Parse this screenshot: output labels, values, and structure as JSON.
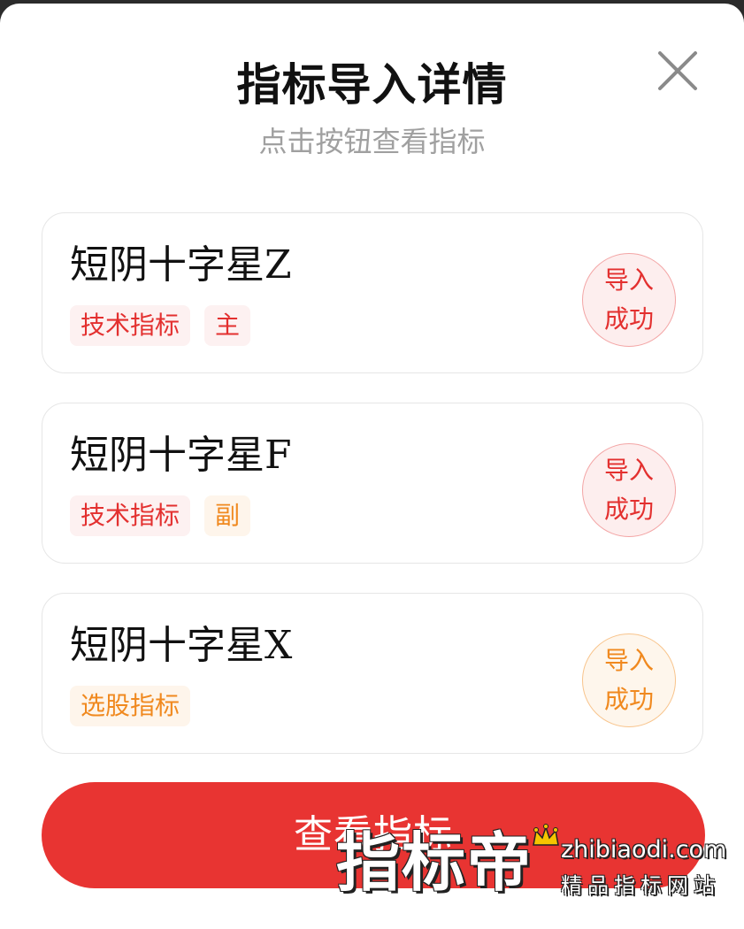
{
  "dialog": {
    "title": "指标导入详情",
    "subtitle": "点击按钮查看指标",
    "close_icon": "close-icon"
  },
  "items": [
    {
      "name": "短阴十字星Z",
      "tags": [
        {
          "label": "技术指标",
          "color": "#e3302f"
        },
        {
          "label": "主",
          "color": "#e3302f"
        }
      ],
      "status_line1": "导入",
      "status_line2": "成功",
      "status_color": "#e3302f"
    },
    {
      "name": "短阴十字星F",
      "tags": [
        {
          "label": "技术指标",
          "color": "#e3302f"
        },
        {
          "label": "副",
          "color": "#f0891f"
        }
      ],
      "status_line1": "导入",
      "status_line2": "成功",
      "status_color": "#e3302f"
    },
    {
      "name": "短阴十字星X",
      "tags": [
        {
          "label": "选股指标",
          "color": "#f0891f"
        }
      ],
      "status_line1": "导入",
      "status_line2": "成功",
      "status_color": "#f0891f"
    }
  ],
  "view_button": {
    "label": "查看指标",
    "color": "#e83432"
  },
  "watermark": {
    "brand": "指标帝",
    "url": "zhibiaodi.com",
    "slogan": "精品指标网站",
    "crown_icon": "crown-icon"
  }
}
